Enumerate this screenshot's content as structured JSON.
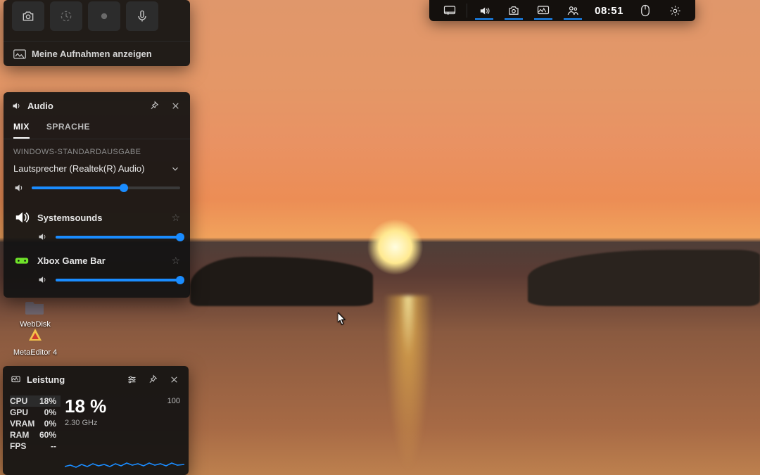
{
  "capture": {
    "footer_label": "Meine Aufnahmen anzeigen",
    "buttons": {
      "screenshot": "camera-icon",
      "last30": "history-icon",
      "record": "record-icon",
      "mic": "mic-icon"
    }
  },
  "audio": {
    "title": "Audio",
    "tabs": {
      "mix": "MIX",
      "sprache": "SPRACHE"
    },
    "section_default_out": "WINDOWS-STANDARDAUSGABE",
    "device": "Lautsprecher (Realtek(R) Audio)",
    "master_volume": 62,
    "apps": [
      {
        "name": "Systemsounds",
        "icon": "speaker",
        "volume": 100
      },
      {
        "name": "Xbox Game Bar",
        "icon": "xbox",
        "volume": 100
      }
    ]
  },
  "desktop_icons": {
    "webdisk": "WebDisk",
    "metaeditor": "MetaEditor 4"
  },
  "perf": {
    "title": "Leistung",
    "rows": [
      {
        "name": "CPU",
        "val": "18%"
      },
      {
        "name": "GPU",
        "val": "0%"
      },
      {
        "name": "VRAM",
        "val": "0%"
      },
      {
        "name": "RAM",
        "val": "60%"
      },
      {
        "name": "FPS",
        "val": "--"
      }
    ],
    "big": "18 %",
    "ghz": "2.30 GHz",
    "ymax": "100"
  },
  "controlbar": {
    "time": "08:51"
  }
}
